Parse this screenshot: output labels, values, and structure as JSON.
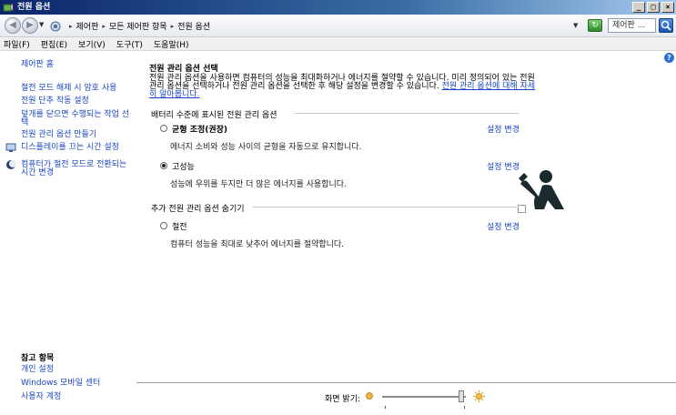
{
  "window": {
    "title": "전원 옵션",
    "minimize": "_",
    "maximize": "□",
    "close": "×"
  },
  "address": {
    "crumbs": [
      "제어판",
      "모든 제어판 항목",
      "전원 옵션"
    ],
    "search_placeholder": "제어판 ..."
  },
  "menu": [
    "파일(F)",
    "편집(E)",
    "보기(V)",
    "도구(T)",
    "도움말(H)"
  ],
  "sidebar": {
    "home": "제어판 홈",
    "items": [
      "절전 모드 해제 시 암호 사용",
      "전원 단추 작동 설정",
      "덮개를 닫으면 수행되는 작업 선택",
      "전원 관리 옵션 만들기",
      "디스플레이를 끄는 시간 설정",
      "컴퓨터가 절전 모드로 전환되는 시간 변경"
    ],
    "see_also": {
      "heading": "참고 항목",
      "items": [
        "개인 설정",
        "Windows 모바일 센터",
        "사용자 계정"
      ]
    }
  },
  "main": {
    "title": "전원 관리 옵션 선택",
    "description": "전원 관리 옵션을 사용하면 컴퓨터의 성능을 최대화하거나 에너지를 절약할 수 있습니다. 미리 정의되어 있는 전원 관리 옵션을 선택하거나 전원 관리 옵션을 선택한 후 해당 설정을 변경할 수 있습니다. ",
    "description_link": "전원 관리 옵션에 대해 자세히 알아봅니다.",
    "battery_group": "배터리 수준에 표시된 전원 관리 옵션",
    "extra_group": "추가 전원 관리 옵션 숨기기",
    "change_label": "설정 변경",
    "plans": [
      {
        "name": "균형 조정(권장)",
        "desc": "에너지 소비와 성능 사이의 균형을 자동으로 유지합니다.",
        "selected": false
      },
      {
        "name": "고성능",
        "desc": "성능에 우위를 두지만 더 많은 에너지를 사용합니다.",
        "selected": true
      },
      {
        "name": "절전",
        "desc": "컴퓨터 성능을 최대로 낮추어 에너지를 절약합니다.",
        "selected": false
      }
    ]
  },
  "brightness": {
    "label": "화면 밝기:",
    "level": 0.95
  },
  "colors": {
    "link": "#1a46c2",
    "titlebar": "#0a246a"
  }
}
